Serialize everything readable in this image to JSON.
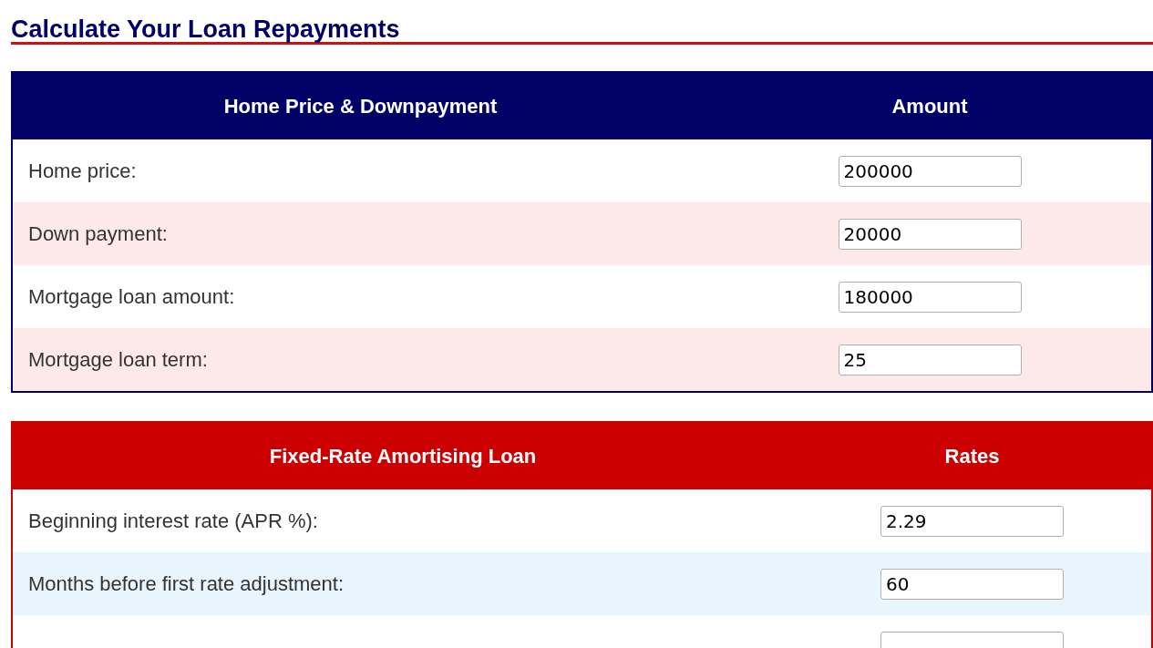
{
  "title": "Calculate Your Loan Repayments",
  "tables": [
    {
      "kind": "amount",
      "columns": [
        "Home Price & Downpayment",
        "Amount"
      ],
      "rows": [
        {
          "label": "Home price:",
          "value": "200000"
        },
        {
          "label": "Down payment:",
          "value": "20000"
        },
        {
          "label": "Mortgage loan amount:",
          "value": "180000"
        },
        {
          "label": "Mortgage loan term:",
          "value": "25"
        }
      ]
    },
    {
      "kind": "rates",
      "columns": [
        "Fixed-Rate Amortising Loan",
        "Rates"
      ],
      "rows": [
        {
          "label": "Beginning interest rate (APR %):",
          "value": "2.29"
        },
        {
          "label": "Months before first rate adjustment:",
          "value": "60"
        }
      ]
    }
  ]
}
